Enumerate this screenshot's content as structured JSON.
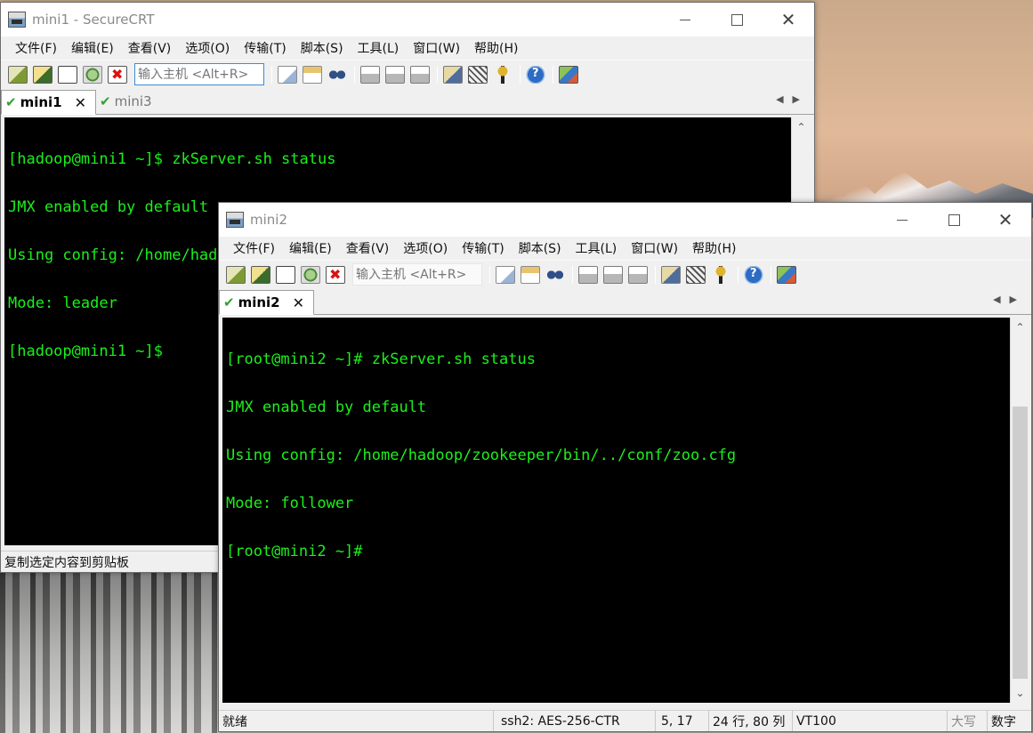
{
  "window1": {
    "title": "mini1 - SecureCRT",
    "menu": [
      "文件(F)",
      "编辑(E)",
      "查看(V)",
      "选项(O)",
      "传输(T)",
      "脚本(S)",
      "工具(L)",
      "窗口(W)",
      "帮助(H)"
    ],
    "host_placeholder": "输入主机 <Alt+R>",
    "tabs": [
      {
        "label": "mini1",
        "active": true
      },
      {
        "label": "mini3",
        "active": false
      }
    ],
    "terminal_lines": [
      "[hadoop@mini1 ~]$ zkServer.sh status",
      "JMX enabled by default",
      "Using config: /home/hadoop/zookeeper/bin/../conf/zoo.cfg",
      "Mode: leader",
      "[hadoop@mini1 ~]$"
    ],
    "status_text": "复制选定内容到剪贴板"
  },
  "window2": {
    "title": "mini2",
    "menu": [
      "文件(F)",
      "编辑(E)",
      "查看(V)",
      "选项(O)",
      "传输(T)",
      "脚本(S)",
      "工具(L)",
      "窗口(W)",
      "帮助(H)"
    ],
    "host_placeholder": "输入主机 <Alt+R>",
    "tabs": [
      {
        "label": "mini2",
        "active": true
      }
    ],
    "terminal_lines": [
      "[root@mini2 ~]# zkServer.sh status",
      "JMX enabled by default",
      "Using config: /home/hadoop/zookeeper/bin/../conf/zoo.cfg",
      "Mode: follower",
      "[root@mini2 ~]#"
    ],
    "status": {
      "ready": "就绪",
      "cipher": "ssh2: AES-256-CTR",
      "cursor": "5,  17",
      "size": "24 行, 80 列",
      "term": "VT100",
      "caps": "大写",
      "num": "数字"
    }
  },
  "colors": {
    "terminal_fg": "#1bf01b",
    "terminal_bg": "#000000",
    "tab_check": "#33a133"
  },
  "icons": {
    "toolbar": [
      "connect-icon",
      "quick-connect-icon",
      "connect-in-tab-icon",
      "reconnect-icon",
      "disconnect-icon",
      "copy-icon",
      "paste-icon",
      "find-icon",
      "print-icon",
      "print-setup-icon",
      "print-selection-icon",
      "session-options-icon",
      "sftp-icon",
      "keymap-icon",
      "help-icon",
      "connect-map-icon"
    ]
  }
}
